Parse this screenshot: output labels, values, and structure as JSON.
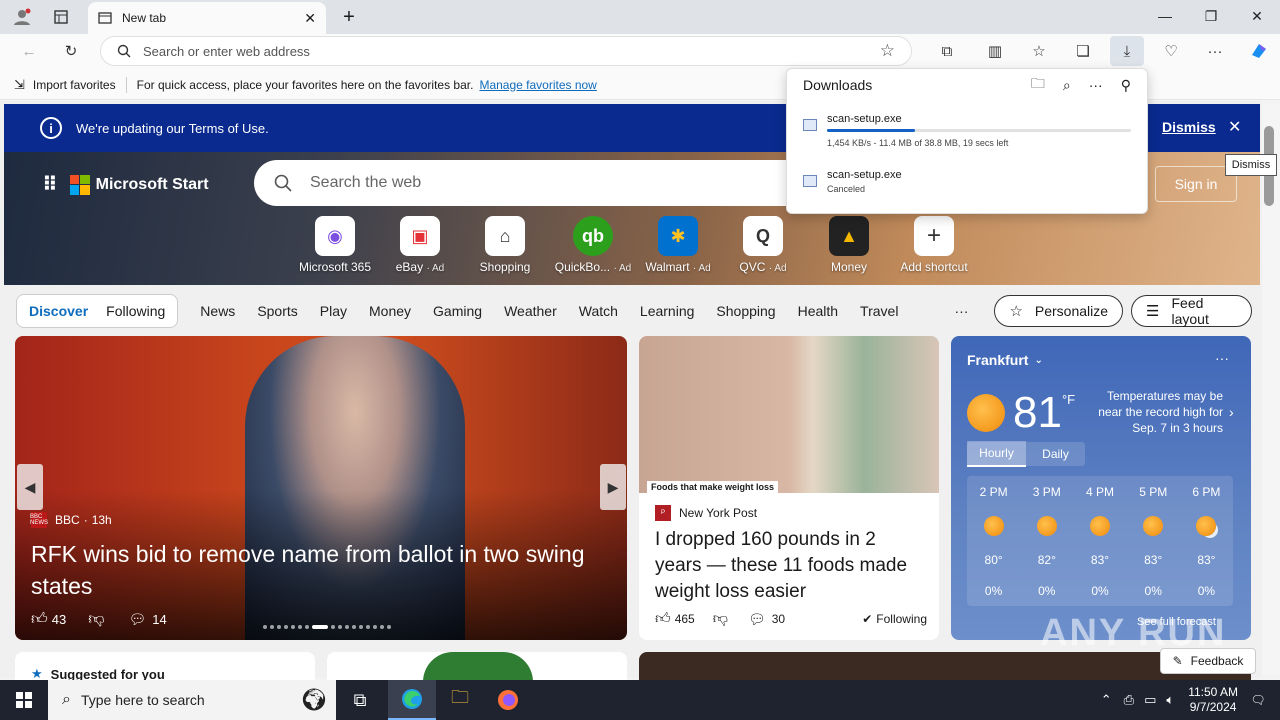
{
  "browser": {
    "tab_title": "New tab",
    "address_placeholder": "Search or enter web address"
  },
  "favbar": {
    "import_label": "Import favorites",
    "hint": "For quick access, place your favorites here on the favorites bar.",
    "manage_link": "Manage favorites now"
  },
  "terms_banner": {
    "text": "We're updating our Terms of Use.",
    "dismiss": "Dismiss"
  },
  "tooltip": "Dismiss",
  "hero": {
    "brand": "Microsoft Start",
    "search_placeholder": "Search the web",
    "sign_in": "Sign in",
    "shortcuts": [
      {
        "label": "Microsoft 365",
        "ad": ""
      },
      {
        "label": "eBay",
        "ad": "· Ad"
      },
      {
        "label": "Shopping",
        "ad": ""
      },
      {
        "label": "QuickBo...",
        "ad": "· Ad"
      },
      {
        "label": "Walmart",
        "ad": "· Ad"
      },
      {
        "label": "QVC",
        "ad": "· Ad"
      },
      {
        "label": "Money",
        "ad": ""
      },
      {
        "label": "Add shortcut",
        "ad": ""
      }
    ]
  },
  "feednav": {
    "pills": [
      "Discover",
      "Following"
    ],
    "links": [
      "News",
      "Sports",
      "Play",
      "Money",
      "Gaming",
      "Weather",
      "Watch",
      "Learning",
      "Shopping",
      "Health",
      "Travel"
    ],
    "more": "···",
    "personalize": "Personalize",
    "feed_layout": "Feed layout"
  },
  "hero_card": {
    "source": "BBC",
    "age": "13h",
    "source_logo": "BBC NEWS",
    "headline": "RFK wins bid to remove name from ballot in two swing states",
    "likes": "43",
    "comments": "14"
  },
  "card2": {
    "caption": "Foods that make weight loss",
    "source": "New York Post",
    "headline": "I dropped 160 pounds in 2 years — these 11 foods made weight loss easier",
    "likes": "465",
    "comments": "30",
    "following": "Following"
  },
  "weather": {
    "city": "Frankfurt",
    "temp": "81",
    "unit": "°F",
    "note": "Temperatures may be near the record high for Sep. 7 in 3 hours",
    "tabs": [
      "Hourly",
      "Daily"
    ],
    "hours": [
      {
        "time": "2 PM",
        "temp": "80°",
        "precip": "0%"
      },
      {
        "time": "3 PM",
        "temp": "82°",
        "precip": "0%"
      },
      {
        "time": "4 PM",
        "temp": "83°",
        "precip": "0%"
      },
      {
        "time": "5 PM",
        "temp": "83°",
        "precip": "0%"
      },
      {
        "time": "6 PM",
        "temp": "83°",
        "precip": "0%"
      }
    ],
    "full_forecast": "See full forecast"
  },
  "row3": {
    "suggested": "Suggested for you"
  },
  "feedback": "Feedback",
  "watermark": "ANY RUN",
  "downloads": {
    "title": "Downloads",
    "items": [
      {
        "name": "scan-setup.exe",
        "status": "1,454 KB/s - 11.4 MB of 38.8 MB, 19 secs left",
        "progress": 0.29
      },
      {
        "name": "scan-setup.exe",
        "status": "Canceled"
      }
    ]
  },
  "taskbar": {
    "search_placeholder": "Type here to search",
    "time": "11:50 AM",
    "date": "9/7/2024"
  },
  "colors": {
    "accent": "#0f6cbd",
    "terms_banner": "#0a2a8f",
    "taskbar": "#1f2330"
  }
}
